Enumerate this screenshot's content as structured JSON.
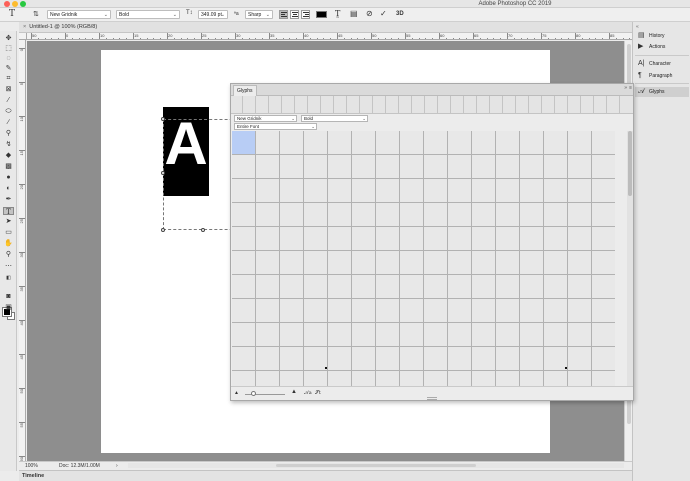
{
  "app": {
    "title": "Adobe Photoshop CC 2019"
  },
  "options_bar": {
    "type_tool_icon": "type-tool-icon",
    "orientation_icon": "text-orientation-icon",
    "font_family": "New Gridnik",
    "font_style": "Bold",
    "font_size": "349.09 pt",
    "font_size_icon": "font-size-icon",
    "aa_label": "ªa",
    "antialias": "Sharp",
    "align": [
      "left",
      "center",
      "right"
    ],
    "align_active": "left",
    "text_color": "#000000",
    "warp_icon": "warp-text-icon",
    "cancel_icon": "cancel-icon",
    "commit_icon": "commit-checkmark-icon",
    "three_d_label": "3D"
  },
  "document": {
    "tab_close": "×",
    "tab_title": "Untitled-1 @ 100% (RGB/8)",
    "canvas_letter": "A",
    "zoom": "100%",
    "doc_size": "Doc: 12.3M/1.00M"
  },
  "ruler": {
    "top": [
      "50",
      "0",
      "10",
      "15",
      "20",
      "25",
      "30",
      "35",
      "40",
      "45",
      "50",
      "55",
      "60",
      "65",
      "70",
      "75",
      "80",
      "85"
    ],
    "left": [
      "0",
      "5",
      "10",
      "15",
      "20",
      "25",
      "30",
      "35",
      "40",
      "45",
      "50",
      "55",
      "60"
    ]
  },
  "panels": {
    "items": [
      {
        "label": "History",
        "icon": "history-icon",
        "active": false
      },
      {
        "label": "Actions",
        "icon": "actions-play-icon",
        "active": false
      },
      {
        "label": "Character",
        "icon": "character-icon",
        "active": false
      },
      {
        "label": "Paragraph",
        "icon": "paragraph-icon",
        "active": false
      },
      {
        "label": "Glyphs",
        "icon": "glyphs-icon",
        "active": true
      }
    ]
  },
  "glyphs_panel": {
    "tab": "Glyphs",
    "close": "»",
    "menu": "≡",
    "font": "New Gridnik",
    "style": "Bold",
    "show": "Entire Font",
    "bottom_icons": [
      "zoom-out-mountain-icon",
      "zoom-in-mountain-icon",
      "glyph-a-icon",
      "glyph-ligature-icon"
    ]
  },
  "timeline": {
    "label": "Timeline"
  }
}
